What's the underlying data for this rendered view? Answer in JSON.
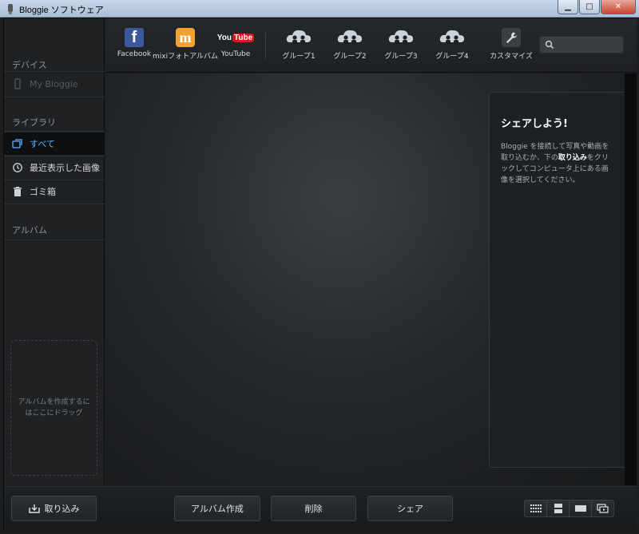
{
  "window": {
    "title": "Bloggie ソフトウェア"
  },
  "sidebar": {
    "devices_title": "デバイス",
    "device_item": "My Bloggie",
    "library_title": "ライブラリ",
    "library_items": [
      {
        "label": "すべて",
        "icon": "stack-icon",
        "selected": true
      },
      {
        "label": "最近表示した画像",
        "icon": "history-icon",
        "selected": false
      },
      {
        "label": "ゴミ箱",
        "icon": "trash-icon",
        "selected": false
      }
    ],
    "album_title": "アルバム",
    "dropzone_text": "アルバムを作成するにはここにドラッグ"
  },
  "toolbar": {
    "facebook": "Facebook",
    "mixi": "mixiフォトアルバム",
    "youtube": "YouTube",
    "youtube_logo_you": "You",
    "youtube_logo_tube": "Tube",
    "groups": [
      "グループ1",
      "グループ2",
      "グループ3",
      "グループ4"
    ],
    "customize": "カスタマイズ",
    "search_placeholder": ""
  },
  "share_panel": {
    "title": "シェアしよう!",
    "body_before": "Bloggie を接続して写真や動画を取り込むか、下の",
    "body_bold": "取り込み",
    "body_after": "をクリックしてコンピュータ上にある画像を選択してください。"
  },
  "bottom": {
    "import_label": "取り込み",
    "create_album_label": "アルバム作成",
    "delete_label": "削除",
    "share_label": "シェア"
  },
  "colors": {
    "accent": "#5fb0ff",
    "facebook": "#3b5a99",
    "mixi": "#f2a233",
    "youtube": "#d21a1a"
  }
}
